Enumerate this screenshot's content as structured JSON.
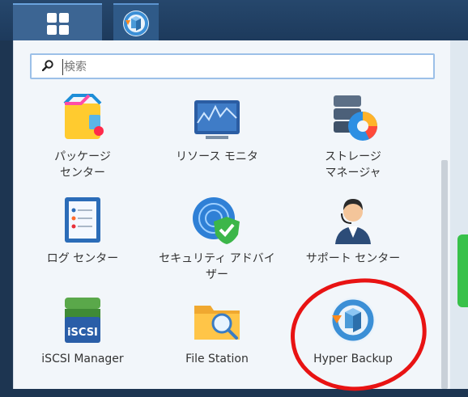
{
  "taskbar": {
    "main_menu_icon": "grid-icon",
    "running_app_icon": "hyper-backup-icon"
  },
  "search": {
    "placeholder": "検索"
  },
  "apps": [
    {
      "label": "パッケージ\nセンター",
      "icon": "package-center-icon"
    },
    {
      "label": "リソース モニタ",
      "icon": "resource-monitor-icon"
    },
    {
      "label": "ストレージ\nマネージャ",
      "icon": "storage-manager-icon"
    },
    {
      "label": "ログ センター",
      "icon": "log-center-icon"
    },
    {
      "label": "セキュリティ アドバイ\nザー",
      "icon": "security-advisor-icon"
    },
    {
      "label": "サポート センター",
      "icon": "support-center-icon"
    },
    {
      "label": "iSCSI Manager",
      "icon": "iscsi-manager-icon"
    },
    {
      "label": "File Station",
      "icon": "file-station-icon"
    },
    {
      "label": "Hyper Backup",
      "icon": "hyper-backup-icon"
    }
  ],
  "annotation": {
    "color": "#e81313"
  }
}
